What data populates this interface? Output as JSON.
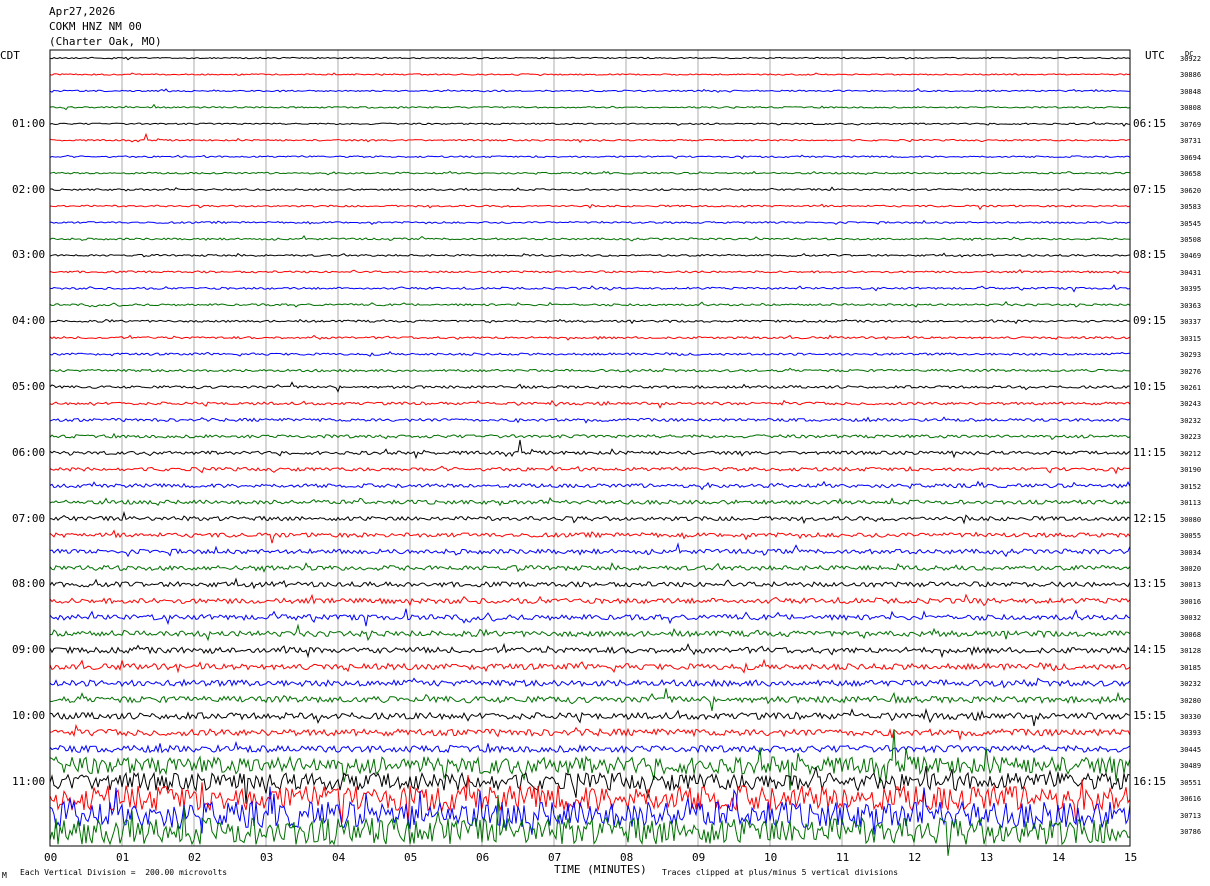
{
  "header": {
    "date": "Apr27,2026",
    "station": "COKM HNZ NM 00",
    "location": "(Charter Oak, MO)"
  },
  "left_tz": "CDT",
  "right_tz": "UTC",
  "dc_label": "DC",
  "footer": {
    "scale_note": "Each Vertical Division =  200.00 microvolts",
    "clip_note": "Traces clipped at plus/minus 5 vertical divisions",
    "corner_mark": "M"
  },
  "colors": [
    "#000000",
    "#ff0000",
    "#0000ff",
    "#007000"
  ],
  "chart_data": {
    "type": "line",
    "title": "COKM HNZ NM 00",
    "xlabel": "TIME (MINUTES)",
    "ylabel": "",
    "xlim": [
      0,
      15
    ],
    "x_ticks": [
      "00",
      "01",
      "02",
      "03",
      "04",
      "05",
      "06",
      "07",
      "08",
      "09",
      "10",
      "11",
      "12",
      "13",
      "14",
      "15"
    ],
    "left_hour_labels": [
      "01:00",
      "02:00",
      "03:00",
      "04:00",
      "05:00",
      "06:00",
      "07:00",
      "08:00",
      "09:00",
      "10:00",
      "11:00"
    ],
    "right_hour_labels": [
      "06:15",
      "07:15",
      "08:15",
      "09:15",
      "10:15",
      "11:15",
      "12:15",
      "13:15",
      "14:15",
      "15:15",
      "16:15"
    ],
    "dc_offsets": [
      30922,
      30886,
      30848,
      30808,
      30769,
      30731,
      30694,
      30658,
      30620,
      30583,
      30545,
      30508,
      30469,
      30431,
      30395,
      30363,
      30337,
      30315,
      30293,
      30276,
      30261,
      30243,
      30232,
      30223,
      30212,
      30190,
      30152,
      30113,
      30080,
      30055,
      30034,
      30020,
      30013,
      30016,
      30032,
      30068,
      30128,
      30185,
      30232,
      30280,
      30330,
      30393,
      30445,
      30489,
      30551,
      30616,
      30713,
      30786
    ],
    "trace_minutes": 15,
    "trace_count": 48,
    "series_colors_cycle": [
      "black",
      "red",
      "blue",
      "green"
    ]
  }
}
